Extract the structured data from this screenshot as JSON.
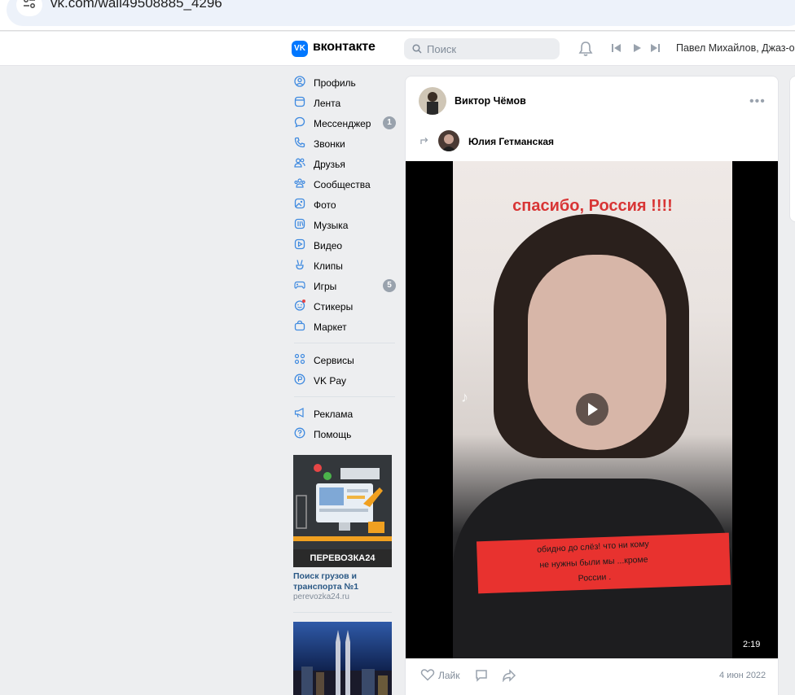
{
  "browser": {
    "url": "vk.com/wall49508885_4296"
  },
  "header": {
    "logo_mark": "VK",
    "wordmark": "вконтакте",
    "search_placeholder": "Поиск",
    "user_name": "Павел Михайлов, Джаз-оркестр"
  },
  "nav": {
    "group1": [
      {
        "label": "Профиль",
        "icon": "user-circle-icon"
      },
      {
        "label": "Лента",
        "icon": "feed-icon"
      },
      {
        "label": "Мессенджер",
        "icon": "message-icon",
        "badge": "1"
      },
      {
        "label": "Звонки",
        "icon": "phone-icon"
      },
      {
        "label": "Друзья",
        "icon": "friends-icon"
      },
      {
        "label": "Сообщества",
        "icon": "communities-icon"
      },
      {
        "label": "Фото",
        "icon": "photo-icon"
      },
      {
        "label": "Музыка",
        "icon": "music-icon"
      },
      {
        "label": "Видео",
        "icon": "video-icon"
      },
      {
        "label": "Клипы",
        "icon": "clips-icon"
      },
      {
        "label": "Игры",
        "icon": "gamepad-icon",
        "badge": "5"
      },
      {
        "label": "Стикеры",
        "icon": "sticker-icon"
      },
      {
        "label": "Маркет",
        "icon": "market-bag-icon"
      }
    ],
    "group2": [
      {
        "label": "Сервисы",
        "icon": "services-grid-icon"
      },
      {
        "label": "VK Pay",
        "icon": "vkpay-icon"
      }
    ],
    "group3": [
      {
        "label": "Реклама",
        "icon": "megaphone-icon"
      },
      {
        "label": "Помощь",
        "icon": "help-icon"
      }
    ]
  },
  "ad": {
    "brand": "ПЕРЕВОЗКА24",
    "title": "Поиск грузов и транспорта №1",
    "domain": "perevozka24.ru"
  },
  "post": {
    "author": "Виктор Чёмов",
    "repost_author": "Юлия Гетманская",
    "video": {
      "caption_top": "спасибо, Россия !!!!",
      "caption_band": "обидно до слёз! что ни кому не нужны были мы ...кроме России .",
      "duration": "2:19"
    },
    "like_label": "Лайк",
    "date": "4 июн 2022"
  },
  "colors": {
    "accent": "#0077ff",
    "link": "#2a5885",
    "muted": "#818c99",
    "badge": "#99a2ad"
  }
}
